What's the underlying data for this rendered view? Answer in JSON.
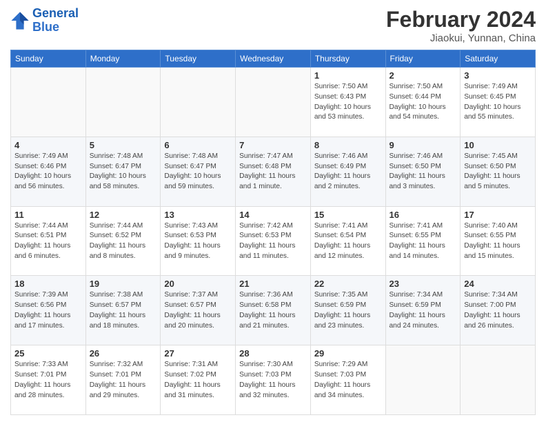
{
  "header": {
    "logo_line1": "General",
    "logo_line2": "Blue",
    "month": "February 2024",
    "location": "Jiaokui, Yunnan, China"
  },
  "weekdays": [
    "Sunday",
    "Monday",
    "Tuesday",
    "Wednesday",
    "Thursday",
    "Friday",
    "Saturday"
  ],
  "weeks": [
    [
      {
        "day": "",
        "info": ""
      },
      {
        "day": "",
        "info": ""
      },
      {
        "day": "",
        "info": ""
      },
      {
        "day": "",
        "info": ""
      },
      {
        "day": "1",
        "info": "Sunrise: 7:50 AM\nSunset: 6:43 PM\nDaylight: 10 hours\nand 53 minutes."
      },
      {
        "day": "2",
        "info": "Sunrise: 7:50 AM\nSunset: 6:44 PM\nDaylight: 10 hours\nand 54 minutes."
      },
      {
        "day": "3",
        "info": "Sunrise: 7:49 AM\nSunset: 6:45 PM\nDaylight: 10 hours\nand 55 minutes."
      }
    ],
    [
      {
        "day": "4",
        "info": "Sunrise: 7:49 AM\nSunset: 6:46 PM\nDaylight: 10 hours\nand 56 minutes."
      },
      {
        "day": "5",
        "info": "Sunrise: 7:48 AM\nSunset: 6:47 PM\nDaylight: 10 hours\nand 58 minutes."
      },
      {
        "day": "6",
        "info": "Sunrise: 7:48 AM\nSunset: 6:47 PM\nDaylight: 10 hours\nand 59 minutes."
      },
      {
        "day": "7",
        "info": "Sunrise: 7:47 AM\nSunset: 6:48 PM\nDaylight: 11 hours\nand 1 minute."
      },
      {
        "day": "8",
        "info": "Sunrise: 7:46 AM\nSunset: 6:49 PM\nDaylight: 11 hours\nand 2 minutes."
      },
      {
        "day": "9",
        "info": "Sunrise: 7:46 AM\nSunset: 6:50 PM\nDaylight: 11 hours\nand 3 minutes."
      },
      {
        "day": "10",
        "info": "Sunrise: 7:45 AM\nSunset: 6:50 PM\nDaylight: 11 hours\nand 5 minutes."
      }
    ],
    [
      {
        "day": "11",
        "info": "Sunrise: 7:44 AM\nSunset: 6:51 PM\nDaylight: 11 hours\nand 6 minutes."
      },
      {
        "day": "12",
        "info": "Sunrise: 7:44 AM\nSunset: 6:52 PM\nDaylight: 11 hours\nand 8 minutes."
      },
      {
        "day": "13",
        "info": "Sunrise: 7:43 AM\nSunset: 6:53 PM\nDaylight: 11 hours\nand 9 minutes."
      },
      {
        "day": "14",
        "info": "Sunrise: 7:42 AM\nSunset: 6:53 PM\nDaylight: 11 hours\nand 11 minutes."
      },
      {
        "day": "15",
        "info": "Sunrise: 7:41 AM\nSunset: 6:54 PM\nDaylight: 11 hours\nand 12 minutes."
      },
      {
        "day": "16",
        "info": "Sunrise: 7:41 AM\nSunset: 6:55 PM\nDaylight: 11 hours\nand 14 minutes."
      },
      {
        "day": "17",
        "info": "Sunrise: 7:40 AM\nSunset: 6:55 PM\nDaylight: 11 hours\nand 15 minutes."
      }
    ],
    [
      {
        "day": "18",
        "info": "Sunrise: 7:39 AM\nSunset: 6:56 PM\nDaylight: 11 hours\nand 17 minutes."
      },
      {
        "day": "19",
        "info": "Sunrise: 7:38 AM\nSunset: 6:57 PM\nDaylight: 11 hours\nand 18 minutes."
      },
      {
        "day": "20",
        "info": "Sunrise: 7:37 AM\nSunset: 6:57 PM\nDaylight: 11 hours\nand 20 minutes."
      },
      {
        "day": "21",
        "info": "Sunrise: 7:36 AM\nSunset: 6:58 PM\nDaylight: 11 hours\nand 21 minutes."
      },
      {
        "day": "22",
        "info": "Sunrise: 7:35 AM\nSunset: 6:59 PM\nDaylight: 11 hours\nand 23 minutes."
      },
      {
        "day": "23",
        "info": "Sunrise: 7:34 AM\nSunset: 6:59 PM\nDaylight: 11 hours\nand 24 minutes."
      },
      {
        "day": "24",
        "info": "Sunrise: 7:34 AM\nSunset: 7:00 PM\nDaylight: 11 hours\nand 26 minutes."
      }
    ],
    [
      {
        "day": "25",
        "info": "Sunrise: 7:33 AM\nSunset: 7:01 PM\nDaylight: 11 hours\nand 28 minutes."
      },
      {
        "day": "26",
        "info": "Sunrise: 7:32 AM\nSunset: 7:01 PM\nDaylight: 11 hours\nand 29 minutes."
      },
      {
        "day": "27",
        "info": "Sunrise: 7:31 AM\nSunset: 7:02 PM\nDaylight: 11 hours\nand 31 minutes."
      },
      {
        "day": "28",
        "info": "Sunrise: 7:30 AM\nSunset: 7:03 PM\nDaylight: 11 hours\nand 32 minutes."
      },
      {
        "day": "29",
        "info": "Sunrise: 7:29 AM\nSunset: 7:03 PM\nDaylight: 11 hours\nand 34 minutes."
      },
      {
        "day": "",
        "info": ""
      },
      {
        "day": "",
        "info": ""
      }
    ]
  ]
}
